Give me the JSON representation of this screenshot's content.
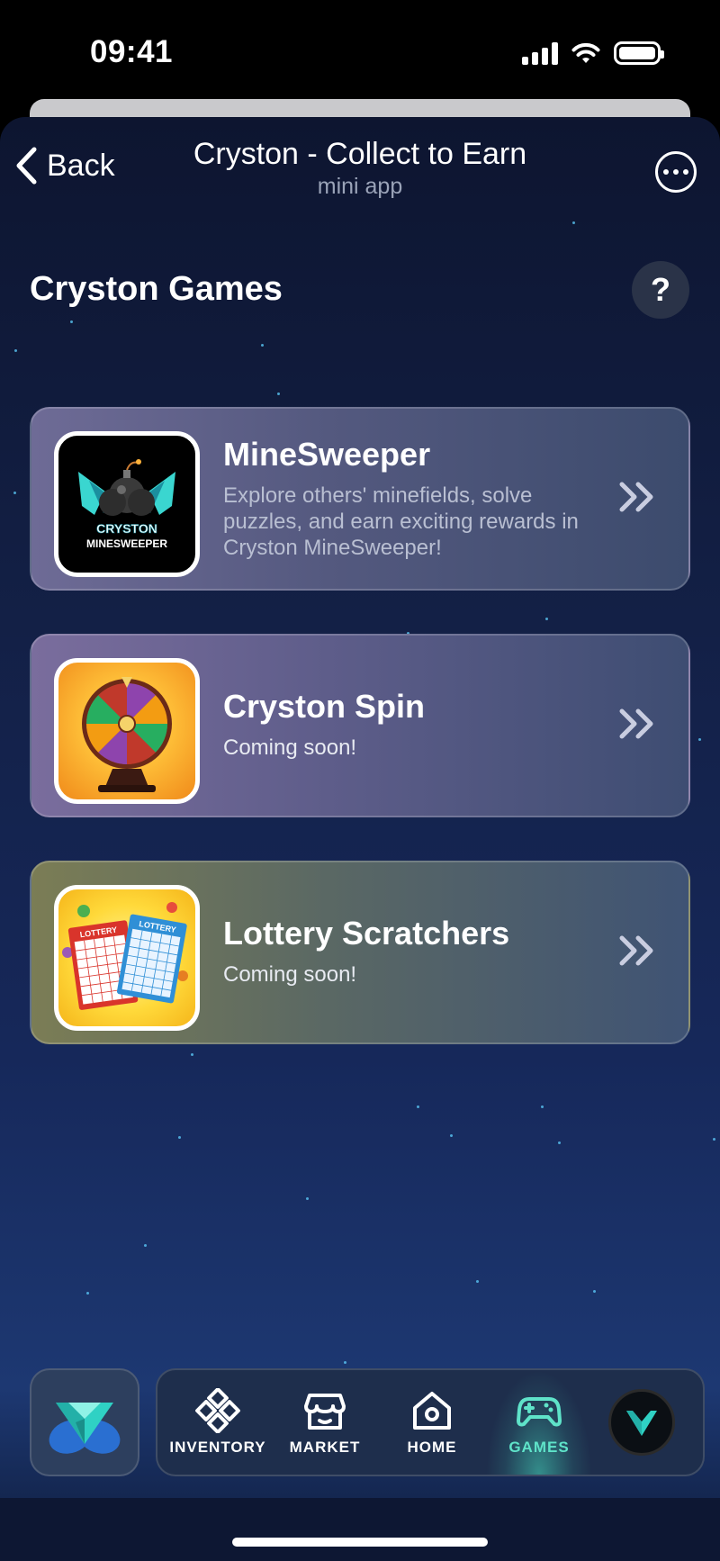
{
  "status_bar": {
    "time": "09:41"
  },
  "header": {
    "back_label": "Back",
    "title": "Cryston - Collect to Earn",
    "subtitle": "mini app"
  },
  "section": {
    "title": "Cryston Games",
    "help_label": "?"
  },
  "games": [
    {
      "title": "MineSweeper",
      "description": "Explore others' minefields, solve puzzles, and earn exciting rewards in Cryston MineSweeper!",
      "thumb_text_1": "CRYSTON",
      "thumb_text_2": "MINESWEEPER"
    },
    {
      "title": "Cryston Spin",
      "description": "Coming soon!"
    },
    {
      "title": "Lottery Scratchers",
      "description": "Coming soon!",
      "thumb_text_1": "LOTTERY",
      "thumb_text_2": "LOTTERY"
    }
  ],
  "tabs": [
    {
      "label": "INVENTORY",
      "icon": "inventory-icon"
    },
    {
      "label": "MARKET",
      "icon": "market-icon"
    },
    {
      "label": "HOME",
      "icon": "home-icon"
    },
    {
      "label": "GAMES",
      "icon": "gamepad-icon",
      "active": true
    }
  ],
  "colors": {
    "accent": "#5fe3c9",
    "background": "#132046"
  }
}
